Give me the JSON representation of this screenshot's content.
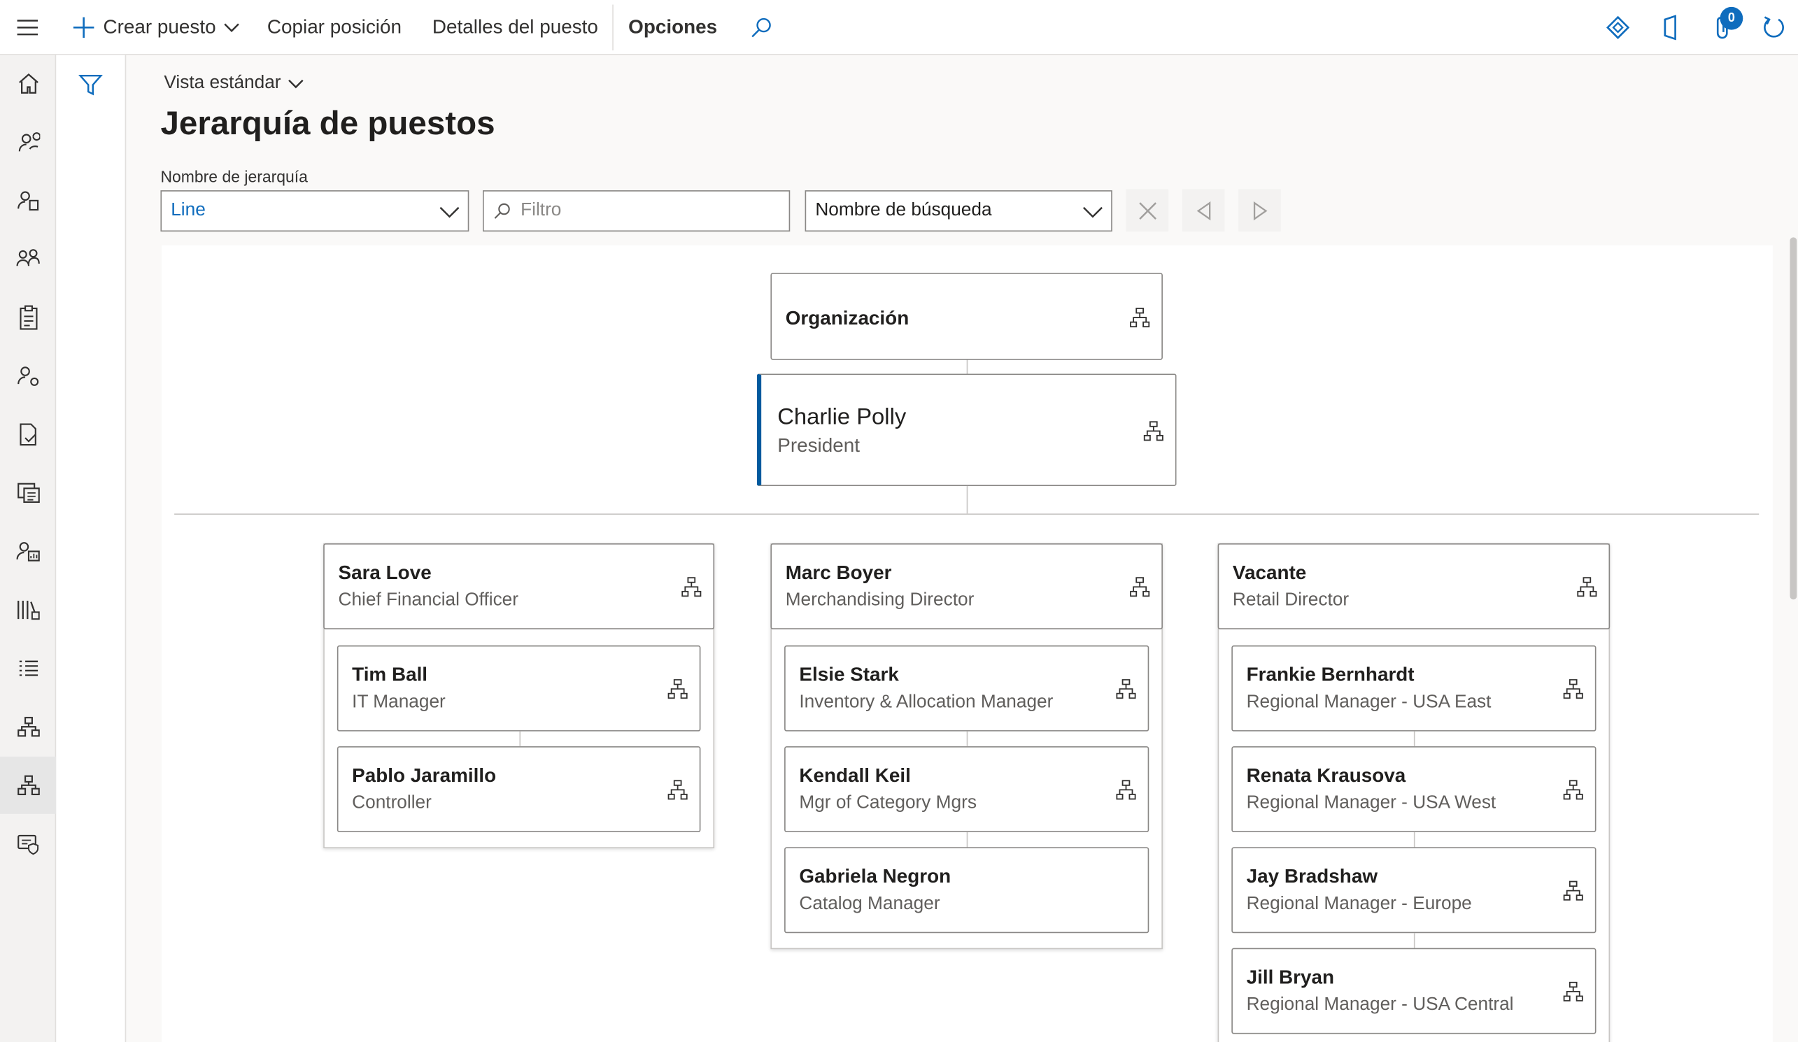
{
  "toolbar": {
    "create_label": "Crear puesto",
    "copy_label": "Copiar posición",
    "details_label": "Detalles del puesto",
    "options_label": "Opciones",
    "notification_count": "0"
  },
  "view": {
    "name": "Vista estándar"
  },
  "page": {
    "title": "Jerarquía de puestos"
  },
  "hierarchy_field": {
    "label": "Nombre de jerarquía",
    "value": "Line"
  },
  "filter_field": {
    "placeholder": "Filtro"
  },
  "search_field": {
    "value": "Nombre de búsqueda"
  },
  "org": {
    "root": {
      "name": "Organización"
    },
    "president": {
      "name": "Charlie Polly",
      "title": "President"
    },
    "columns": [
      {
        "head": {
          "name": "Sara Love",
          "title": "Chief Financial Officer"
        },
        "reports": [
          {
            "name": "Tim Ball",
            "title": "IT Manager"
          },
          {
            "name": "Pablo Jaramillo",
            "title": "Controller"
          }
        ]
      },
      {
        "head": {
          "name": "Marc Boyer",
          "title": "Merchandising Director"
        },
        "reports": [
          {
            "name": "Elsie Stark",
            "title": "Inventory & Allocation Manager"
          },
          {
            "name": "Kendall Keil",
            "title": "Mgr of Category Mgrs"
          },
          {
            "name": "Gabriela Negron",
            "title": "Catalog Manager"
          }
        ]
      },
      {
        "head": {
          "name": "Vacante",
          "title": "Retail Director"
        },
        "reports": [
          {
            "name": "Frankie Bernhardt",
            "title": "Regional Manager - USA East"
          },
          {
            "name": "Renata Krausova",
            "title": "Regional Manager - USA West"
          },
          {
            "name": "Jay Bradshaw",
            "title": "Regional Manager - Europe"
          },
          {
            "name": "Jill Bryan",
            "title": "Regional Manager - USA Central"
          }
        ]
      }
    ]
  },
  "colors": {
    "accent": "#0f6cbd",
    "selected_bar": "#005a9e"
  }
}
